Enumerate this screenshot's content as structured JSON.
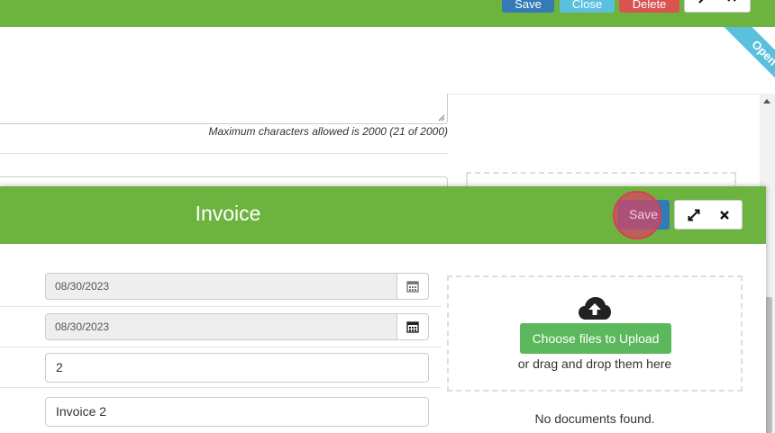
{
  "background": {
    "toolbar": {
      "save_label": "Save",
      "close_label": "Close",
      "delete_label": "Delete"
    },
    "ribbon_label": "Open",
    "char_limit_note": "Maximum characters allowed is 2000 (21 of 2000)"
  },
  "invoice_modal": {
    "title": "Invoice",
    "save_label": "Save",
    "fields": {
      "date_1": "08/30/2023",
      "date_2": "08/30/2023",
      "number": "2",
      "name": "Invoice 2"
    },
    "upload": {
      "button_label": "Choose files to Upload",
      "drag_text": "or drag and drop them here",
      "empty_text": "No documents found."
    }
  },
  "colors": {
    "header_green": "#6db33f",
    "primary_blue": "#337ab7",
    "info_cyan": "#5bc0de",
    "danger_red": "#d9534f",
    "success_green": "#5cb85c",
    "highlight_pink": "#d64664"
  },
  "icons": {
    "expand": "expand-arrows-icon",
    "close": "close-x-icon",
    "calendar": "calendar-icon",
    "upload": "cloud-upload-icon"
  }
}
